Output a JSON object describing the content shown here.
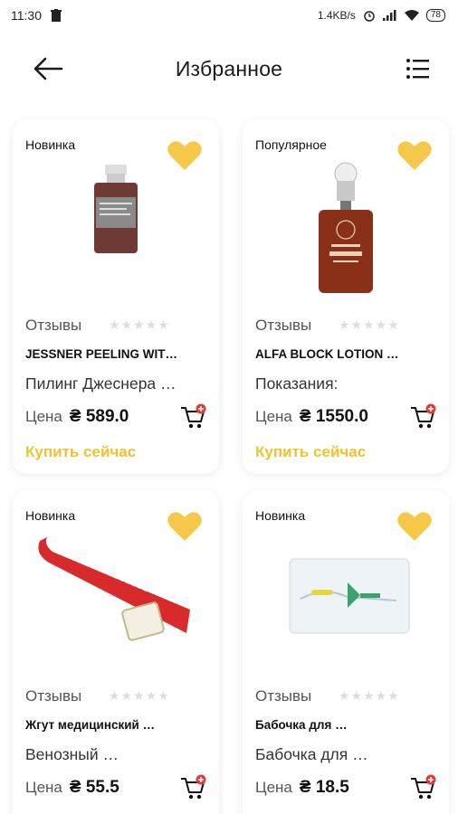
{
  "status": {
    "time": "11:30",
    "speed": "1.4KB/s",
    "battery": "78"
  },
  "header": {
    "title": "Избранное"
  },
  "colors": {
    "accent": "#f2c12e",
    "heart": "#f5c84a",
    "cart_badge": "#e53935"
  },
  "products": [
    {
      "tag": "Новинка",
      "reviews_label": "Отзывы",
      "stars": "★★★★★",
      "name": "JESSNER PEELING WIT…",
      "desc": "Пилинг Джеснера …",
      "price_label": "Цена",
      "price": "₴ 589.0",
      "buy": "Купить сейчас"
    },
    {
      "tag": "Популярное",
      "reviews_label": "Отзывы",
      "stars": "★★★★★",
      "name": "ALFA BLOCK LOTION …",
      "desc": "Показания:",
      "price_label": "Цена",
      "price": "₴ 1550.0",
      "buy": "Купить сейчас"
    },
    {
      "tag": "Новинка",
      "reviews_label": "Отзывы",
      "stars": "★★★★★",
      "name": "Жгут медицинский …",
      "desc": "Венозный …",
      "price_label": "Цена",
      "price": "₴ 55.5",
      "buy": ""
    },
    {
      "tag": "Новинка",
      "reviews_label": "Отзывы",
      "stars": "★★★★★",
      "name": "Бабочка для …",
      "desc": "Бабочка для …",
      "price_label": "Цена",
      "price": "₴ 18.5",
      "buy": ""
    }
  ]
}
